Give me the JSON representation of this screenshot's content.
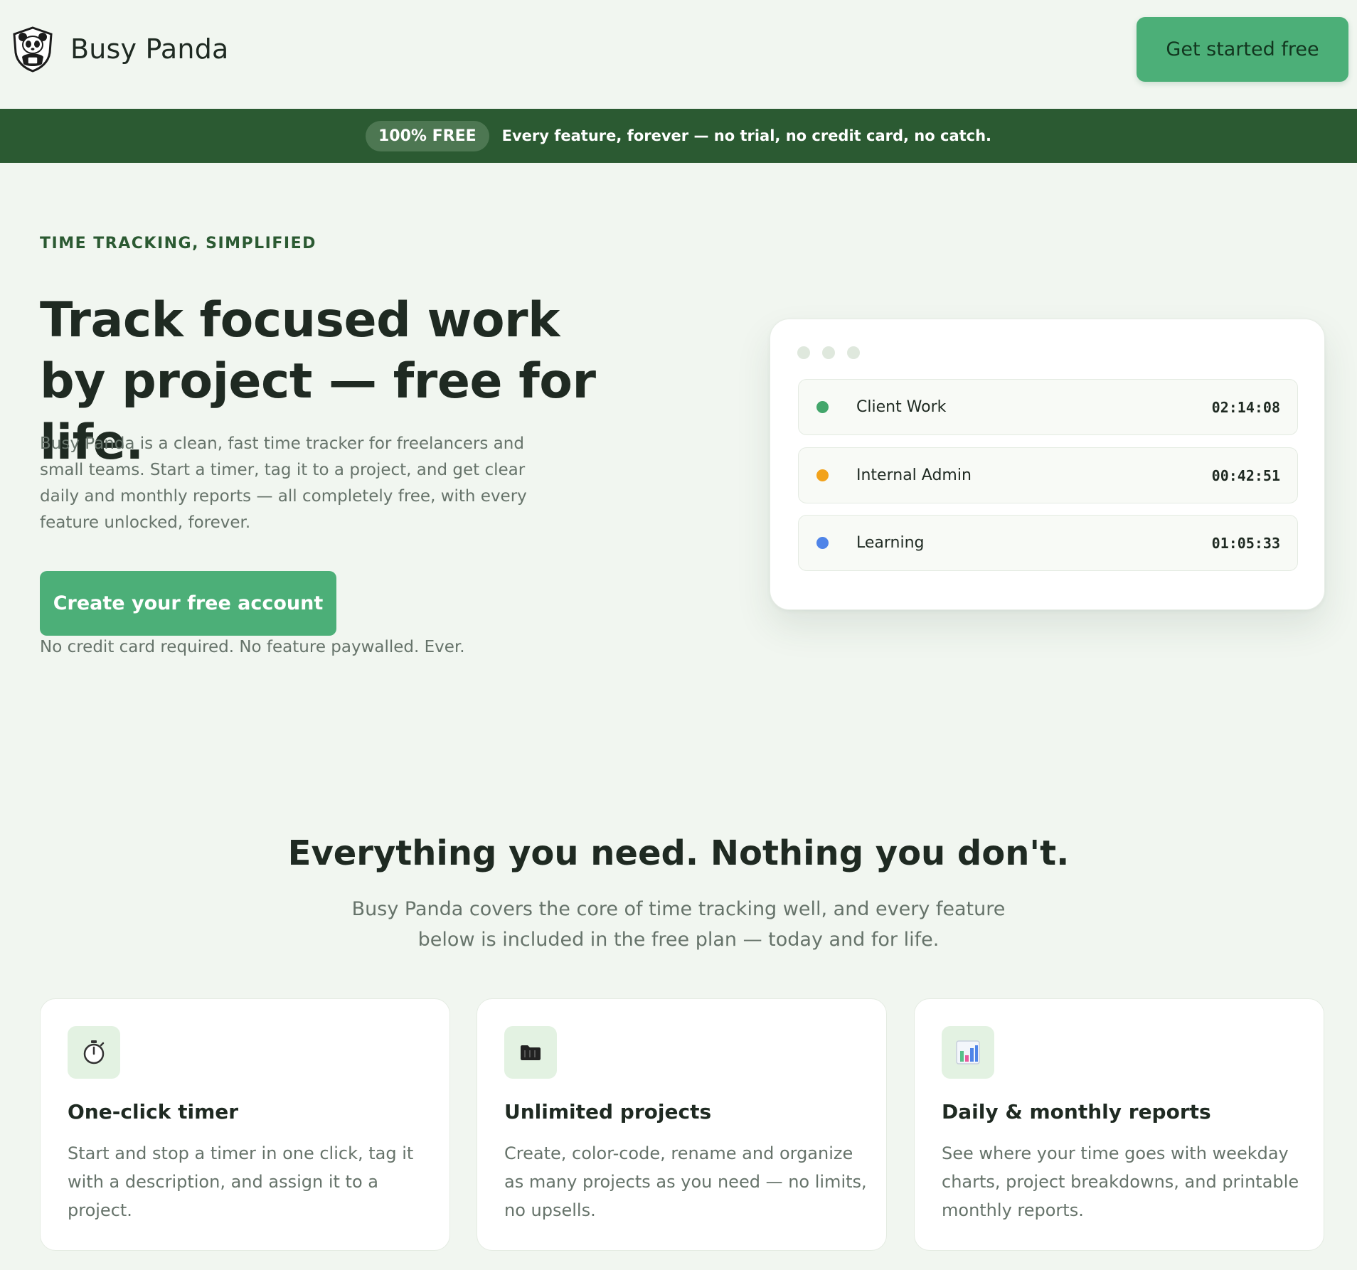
{
  "header": {
    "brand": "Busy Panda",
    "logo_icon": "panda-shield-icon",
    "cta_label": "Get started free"
  },
  "banner": {
    "pill": "100% FREE",
    "text": "Every feature, forever — no trial, no credit card, no catch."
  },
  "hero": {
    "eyebrow": "TIME TRACKING, SIMPLIFIED",
    "title": "Track focused work by project — free for life.",
    "description": "Busy Panda is a clean, fast time tracker for freelancers and small teams. Start a timer, tag it to a project, and get clear daily and monthly reports — all completely free, with every feature unlocked, forever.",
    "cta_label": "Create your free account",
    "note": "No credit card required. No feature paywalled. Ever."
  },
  "mock": {
    "projects": [
      {
        "name": "Client Work",
        "time": "02:14:08",
        "color": "#43a66b"
      },
      {
        "name": "Internal Admin",
        "time": "00:42:51",
        "color": "#f2a21b"
      },
      {
        "name": "Learning",
        "time": "01:05:33",
        "color": "#4f84e8"
      }
    ]
  },
  "features": {
    "title": "Everything you need. Nothing you don't.",
    "subtitle": "Busy Panda covers the core of time tracking well, and every feature below is included in the free plan — today and for life.",
    "cards": [
      {
        "icon": "stopwatch-icon",
        "title": "One-click timer",
        "description": "Start and stop a timer in one click, tag it with a description, and assign it to a project."
      },
      {
        "icon": "folder-icon",
        "title": "Unlimited projects",
        "description": "Create, color-code, rename and organize as many projects as you need — no limits, no upsells."
      },
      {
        "icon": "bar-chart-icon",
        "title": "Daily & monthly reports",
        "description": "See where your time goes with weekday charts, project breakdowns, and printable monthly reports."
      }
    ]
  },
  "colors": {
    "page_background": "#f1f6f0",
    "accent_green": "#4caf78",
    "banner_green": "#2b5a32",
    "text_dark": "#1f2a22",
    "text_muted": "#66736a"
  }
}
